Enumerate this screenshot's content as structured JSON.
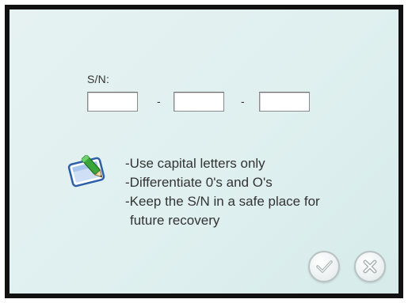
{
  "serial": {
    "label": "S/N:",
    "separator": "-",
    "fields": [
      {
        "value": ""
      },
      {
        "value": ""
      },
      {
        "value": ""
      }
    ]
  },
  "notes": {
    "lines": [
      "-Use capital letters only",
      "-Differentiate 0's and O's",
      "-Keep the S/N in a safe place for",
      "future recovery"
    ],
    "icon": "notepad-pen-icon"
  },
  "buttons": {
    "ok_icon": "checkmark-icon",
    "cancel_icon": "close-x-icon"
  },
  "colors": {
    "background": "#dff0ef",
    "frame": "#111111",
    "text": "#333333",
    "button_ring": "#b9c2c2",
    "pen_green": "#3aa53a",
    "note_blue": "#5d8fd6"
  }
}
